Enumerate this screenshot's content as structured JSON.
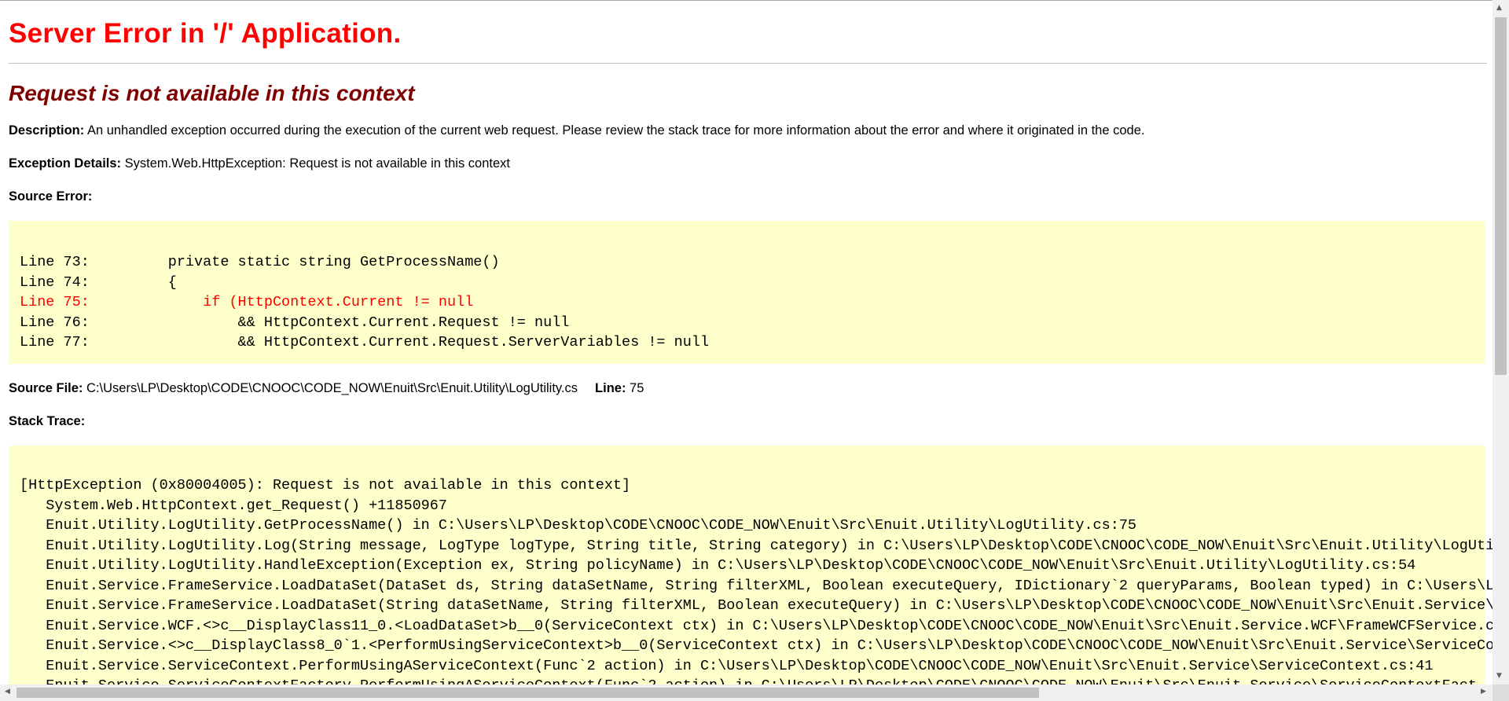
{
  "title": "Server Error in '/' Application.",
  "subtitle": "Request is not available in this context",
  "description": {
    "label": "Description:",
    "text": " An unhandled exception occurred during the execution of the current web request. Please review the stack trace for more information about the error and where it originated in the code."
  },
  "exception": {
    "label": "Exception Details:",
    "text": " System.Web.HttpException: Request is not available in this context"
  },
  "source_error_label": "Source Error:",
  "source_lines": [
    {
      "text": "Line 73:         private static string GetProcessName()",
      "highlight": false
    },
    {
      "text": "Line 74:         {",
      "highlight": false
    },
    {
      "text": "Line 75:             if (HttpContext.Current != null",
      "highlight": true
    },
    {
      "text": "Line 76:                 && HttpContext.Current.Request != null",
      "highlight": false
    },
    {
      "text": "Line 77:                 && HttpContext.Current.Request.ServerVariables != null",
      "highlight": false
    }
  ],
  "source_file": {
    "label": "Source File:",
    "path": " C:\\Users\\LP\\Desktop\\CODE\\CNOOC\\CODE_NOW\\Enuit\\Src\\Enuit.Utility\\LogUtility.cs",
    "line_label": "Line:",
    "line_value": " 75"
  },
  "stack_trace_label": "Stack Trace:",
  "stack_lines": [
    "[HttpException (0x80004005): Request is not available in this context]",
    "   System.Web.HttpContext.get_Request() +11850967",
    "   Enuit.Utility.LogUtility.GetProcessName() in C:\\Users\\LP\\Desktop\\CODE\\CNOOC\\CODE_NOW\\Enuit\\Src\\Enuit.Utility\\LogUtility.cs:75",
    "   Enuit.Utility.LogUtility.Log(String message, LogType logType, String title, String category) in C:\\Users\\LP\\Desktop\\CODE\\CNOOC\\CODE_NOW\\Enuit\\Src\\Enuit.Utility\\LogUti",
    "   Enuit.Utility.LogUtility.HandleException(Exception ex, String policyName) in C:\\Users\\LP\\Desktop\\CODE\\CNOOC\\CODE_NOW\\Enuit\\Src\\Enuit.Utility\\LogUtility.cs:54",
    "   Enuit.Service.FrameService.LoadDataSet(DataSet ds, String dataSetName, String filterXML, Boolean executeQuery, IDictionary`2 queryParams, Boolean typed) in C:\\Users\\L",
    "   Enuit.Service.FrameService.LoadDataSet(String dataSetName, String filterXML, Boolean executeQuery) in C:\\Users\\LP\\Desktop\\CODE\\CNOOC\\CODE_NOW\\Enuit\\Src\\Enuit.Service\\",
    "   Enuit.Service.WCF.<>c__DisplayClass11_0.<LoadDataSet>b__0(ServiceContext ctx) in C:\\Users\\LP\\Desktop\\CODE\\CNOOC\\CODE_NOW\\Enuit\\Src\\Enuit.Service.WCF\\FrameWCFService.c",
    "   Enuit.Service.<>c__DisplayClass8_0`1.<PerformUsingServiceContext>b__0(ServiceContext ctx) in C:\\Users\\LP\\Desktop\\CODE\\CNOOC\\CODE_NOW\\Enuit\\Src\\Enuit.Service\\ServiceCo",
    "   Enuit.Service.ServiceContext.PerformUsingAServiceContext(Func`2 action) in C:\\Users\\LP\\Desktop\\CODE\\CNOOC\\CODE_NOW\\Enuit\\Src\\Enuit.Service\\ServiceContext.cs:41",
    "   Enuit.Service.ServiceContextFactory.PerformUsingAServiceContext(Func`2 action) in C:\\Users\\LP\\Desktop\\CODE\\CNOOC\\CODE_NOW\\Enuit\\Src\\Enuit.Service\\ServiceContextFact"
  ],
  "scrollbars": {
    "up_arrow": "▲",
    "down_arrow": "▼",
    "left_arrow": "◀",
    "right_arrow": "▶"
  },
  "colors": {
    "title": "#ff0000",
    "subtitle": "#800000",
    "code_bg": "#ffffcc",
    "error_line": "#ff0000"
  }
}
